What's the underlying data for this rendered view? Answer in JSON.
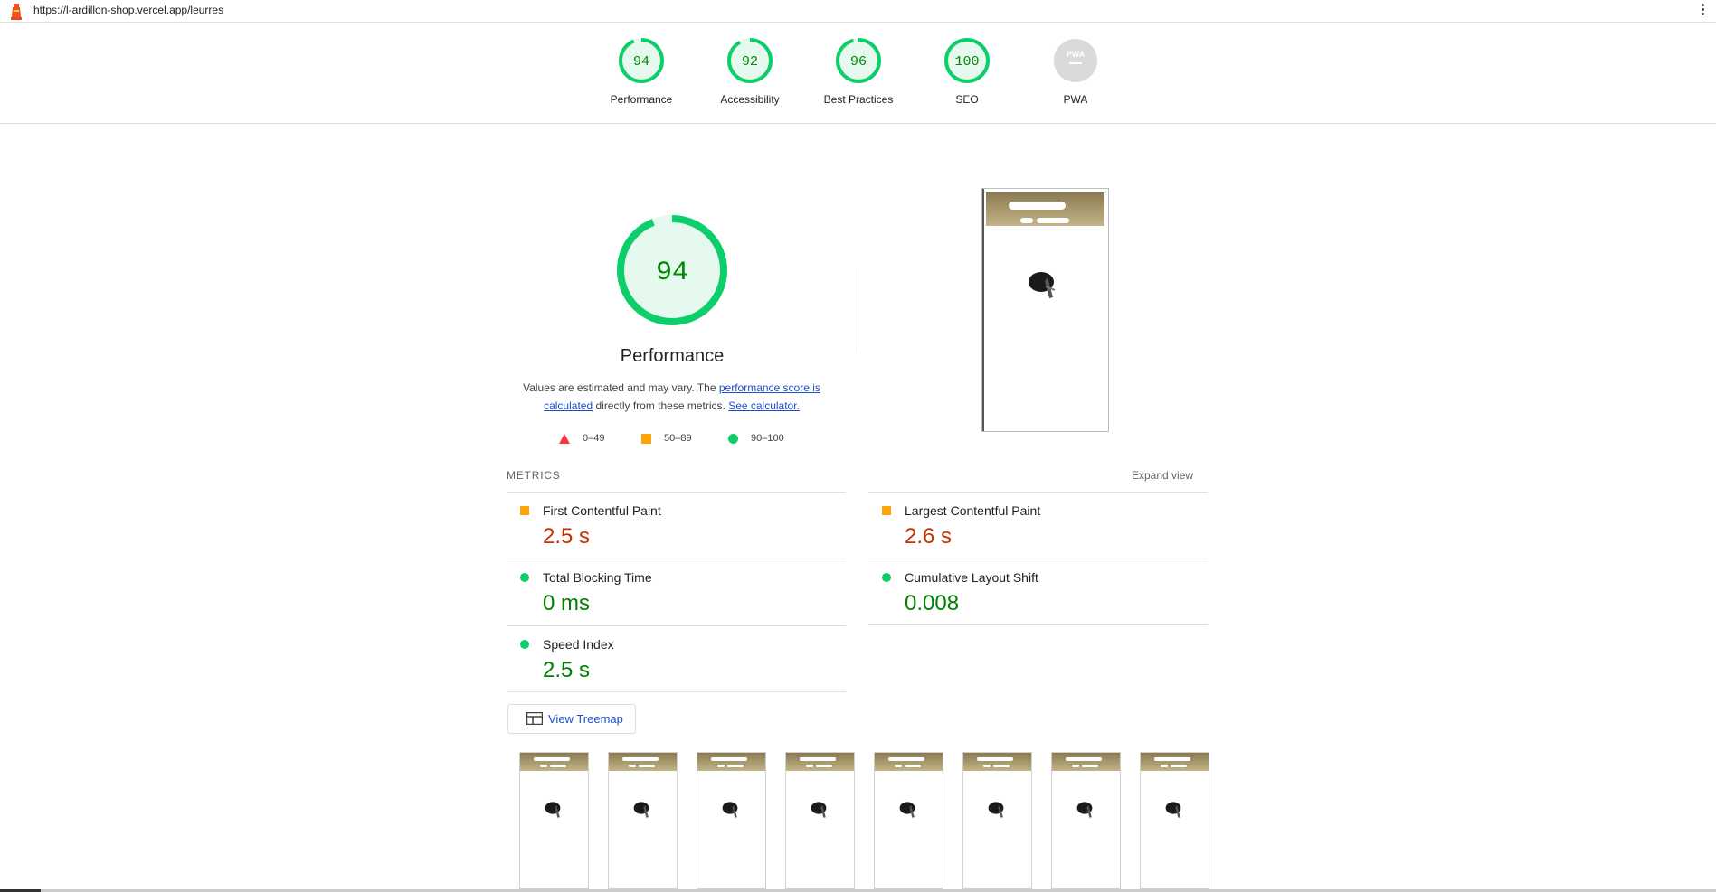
{
  "url": "https://l-ardillon-shop.vercel.app/leurres",
  "gauges": [
    {
      "score": "94",
      "label": "Performance",
      "status": "pass"
    },
    {
      "score": "92",
      "label": "Accessibility",
      "status": "pass"
    },
    {
      "score": "96",
      "label": "Best Practices",
      "status": "pass"
    },
    {
      "score": "100",
      "label": "SEO",
      "status": "pass"
    },
    {
      "score": "PWA",
      "label": "PWA",
      "status": "na"
    }
  ],
  "performance": {
    "score": "94",
    "title": "Performance",
    "desc_prefix": "Values are estimated and may vary. The ",
    "link_score": "performance score is calculated",
    "desc_middle": " directly from these metrics. ",
    "link_calc": "See calculator."
  },
  "legend": [
    {
      "range": "0–49",
      "shape": "triangle",
      "color": "#ff3333"
    },
    {
      "range": "50–89",
      "shape": "square",
      "color": "#ffa400"
    },
    {
      "range": "90–100",
      "shape": "circle",
      "color": "#0cce6b"
    }
  ],
  "metrics": {
    "title": "METRICS",
    "expand": "Expand view",
    "items": [
      {
        "name": "First Contentful Paint",
        "value": "2.5 s",
        "rating": "average"
      },
      {
        "name": "Largest Contentful Paint",
        "value": "2.6 s",
        "rating": "average"
      },
      {
        "name": "Total Blocking Time",
        "value": "0 ms",
        "rating": "pass"
      },
      {
        "name": "Cumulative Layout Shift",
        "value": "0.008",
        "rating": "pass"
      },
      {
        "name": "Speed Index",
        "value": "2.5 s",
        "rating": "pass"
      }
    ]
  },
  "treemap": {
    "label": "View Treemap",
    "icon": "treemap-icon"
  },
  "filmstrip_count": 8,
  "colors": {
    "pass": "#0cce6b",
    "average": "#ffa400",
    "fail": "#ff3333",
    "link": "#1a4fd0"
  }
}
